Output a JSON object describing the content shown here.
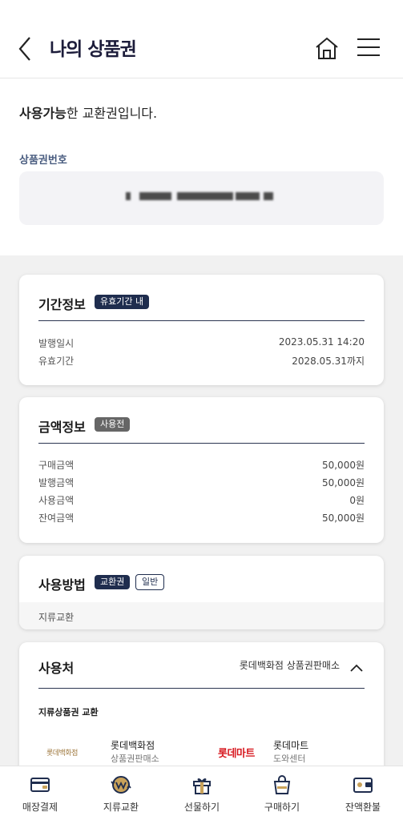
{
  "header": {
    "title": "나의 상품권",
    "back_icon": "back-chevron-icon",
    "home_icon": "home-icon",
    "menu_icon": "hamburger-menu-icon"
  },
  "status": {
    "bold": "사용가능",
    "rest": "한 교환권입니다."
  },
  "voucher_number": {
    "label": "상품권번호",
    "value": "(blurred)"
  },
  "period": {
    "title": "기간정보",
    "badge": "유효기간 내",
    "rows": [
      {
        "label": "발행일시",
        "value": "2023.05.31 14:20"
      },
      {
        "label": "유효기간",
        "value": "2028.05.31까지"
      }
    ]
  },
  "amount": {
    "title": "금액정보",
    "badge": "사용전",
    "rows": [
      {
        "label": "구매금액",
        "value": "50,000원"
      },
      {
        "label": "발행금액",
        "value": "50,000원"
      },
      {
        "label": "사용금액",
        "value": "0원"
      },
      {
        "label": "잔여금액",
        "value": "50,000원"
      }
    ]
  },
  "method": {
    "title": "사용방법",
    "badge_primary": "교환권",
    "badge_secondary": "일반",
    "detail": "지류교환"
  },
  "stores": {
    "title": "사용처",
    "summary": "롯데백화점 상품권판매소",
    "subhead": "지류상품권 교환",
    "items": [
      {
        "logo": "롯데백화점",
        "name": "롯데백화점",
        "sub": "상품권판매소"
      },
      {
        "logo": "롯데마트",
        "name": "롯데마트",
        "sub": "도와센터"
      }
    ]
  },
  "bottom_nav": [
    {
      "label": "매장결제",
      "icon": "card-payment-icon"
    },
    {
      "label": "지류교환",
      "icon": "exchange-coin-icon"
    },
    {
      "label": "선물하기",
      "icon": "gift-icon"
    },
    {
      "label": "구매하기",
      "icon": "shopping-bag-icon"
    },
    {
      "label": "잔액환불",
      "icon": "wallet-refund-icon"
    }
  ],
  "colors": {
    "navy": "#1f2d4e",
    "label_blue": "#4a5d80",
    "mart_red": "#d71920"
  }
}
